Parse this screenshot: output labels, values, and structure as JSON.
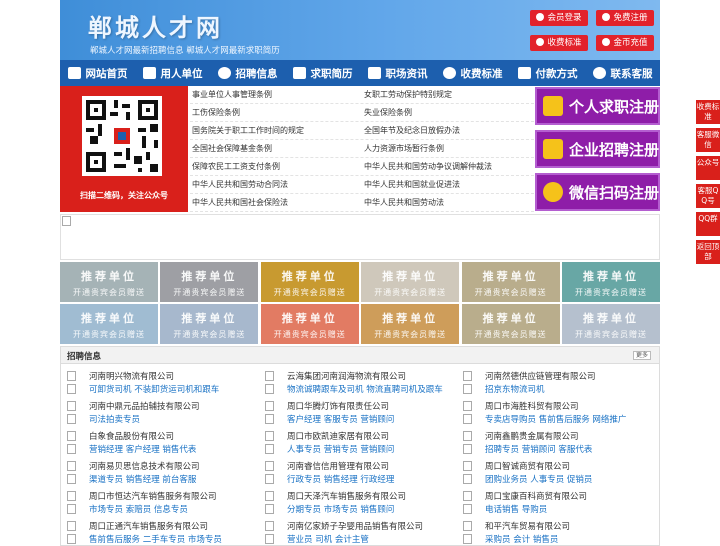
{
  "header": {
    "title": "郸城人才网",
    "slogan": "郸城人才网最新招聘信息   郸城人才网最新求职简历",
    "buttons": [
      "会员登录",
      "免费注册",
      "收费标准",
      "金币充值"
    ]
  },
  "nav": [
    "网站首页",
    "用人单位",
    "招聘信息",
    "求职简历",
    "职场资讯",
    "收费标准",
    "付款方式",
    "联系客服"
  ],
  "qr_caption": "扫描二维码，关注公众号",
  "links": [
    [
      "事业单位人事管理条例",
      "女职工劳动保护特别规定"
    ],
    [
      "工伤保险条例",
      "失业保险条例"
    ],
    [
      "国务院关于职工工作时间的规定",
      "全国年节及纪念日放假办法"
    ],
    [
      "全国社会保障基金条例",
      "人力资源市场暂行条例"
    ],
    [
      "保障农民工工资支付条例",
      "中华人民共和国劳动争议调解仲裁法"
    ],
    [
      "中华人民共和国劳动合同法",
      "中华人民共和国就业促进法"
    ],
    [
      "中华人民共和国社会保险法",
      "中华人民共和国劳动法"
    ]
  ],
  "register": [
    "个人求职注册",
    "企业招聘注册",
    "微信扫码注册"
  ],
  "tiles": {
    "line1": "推荐单位",
    "line2": "开通贵宾会员赠送",
    "colors": [
      "#a5b3b6",
      "#9e9fa4",
      "#c89a30",
      "#cfc8bb",
      "#b9ad8c",
      "#68a7a5",
      "#a0bcd2",
      "#a7b8cd",
      "#e27b63",
      "#ce9d5a",
      "#b9ad8c",
      "#b5c0ce"
    ]
  },
  "jobs": {
    "title": "招聘信息",
    "more": "更多",
    "items": [
      {
        "company": "河南明兴物流有限公司",
        "positions": "可卸货司机 不装卸货运司机和跟车"
      },
      {
        "company": "云海集团河南润海物流有限公司",
        "positions": "物流诚聘跟车及司机 物流直聘司机及跟车"
      },
      {
        "company": "河南然德供应链管理有限公司",
        "positions": "招京东物流司机"
      },
      {
        "company": "河南中鼎元品拍辅技有限公司",
        "positions": "司法拍卖专员"
      },
      {
        "company": "周口华腾灯饰有限责任公司",
        "positions": "客户经理 客服专员 营销顾问"
      },
      {
        "company": "周口市海胜科贸有限公司",
        "positions": "专卖店导购员 售前售后服务 网络推广"
      },
      {
        "company": "白象食品股份有限公司",
        "positions": "营销经理 客户经理 销售代表"
      },
      {
        "company": "周口市欧凯迪家居有限公司",
        "positions": "人事专员 营销专员 营销顾问"
      },
      {
        "company": "河南鑫鹏贵金属有限公司",
        "positions": "招聘专员 营销顾问 客服代表"
      },
      {
        "company": "河南易贝思信息技术有限公司",
        "positions": "渠道专员 销售经理 前台客服"
      },
      {
        "company": "河南睿信信用管理有限公司",
        "positions": "行政专员 销售经理 行政经理"
      },
      {
        "company": "周口智诚商贸有限公司",
        "positions": "团购业务员 人事专员 促销员"
      },
      {
        "company": "周口市恒达汽车销售服务有限公司",
        "positions": "市场专员 索赔员 信息专员"
      },
      {
        "company": "周口天泽汽车销售服务有限公司",
        "positions": "分期专员 市场专员 销售顾问"
      },
      {
        "company": "周口宝康百科商贸有限公司",
        "positions": "电话销售 导购员"
      },
      {
        "company": "周口正通汽车销售服务有限公司",
        "positions": "售前售后服务 二手车专员 市场专员"
      },
      {
        "company": "河南亿家娇子孕婴用品销售有限公司",
        "positions": "营业员 司机 会计主管"
      },
      {
        "company": "和平汽车贸易有限公司",
        "positions": "采购员 会计 销售员"
      }
    ]
  },
  "side": [
    "收费标准",
    "客服微信",
    "公众号",
    "客服QQ号",
    "QQ群",
    "返回顶部"
  ]
}
